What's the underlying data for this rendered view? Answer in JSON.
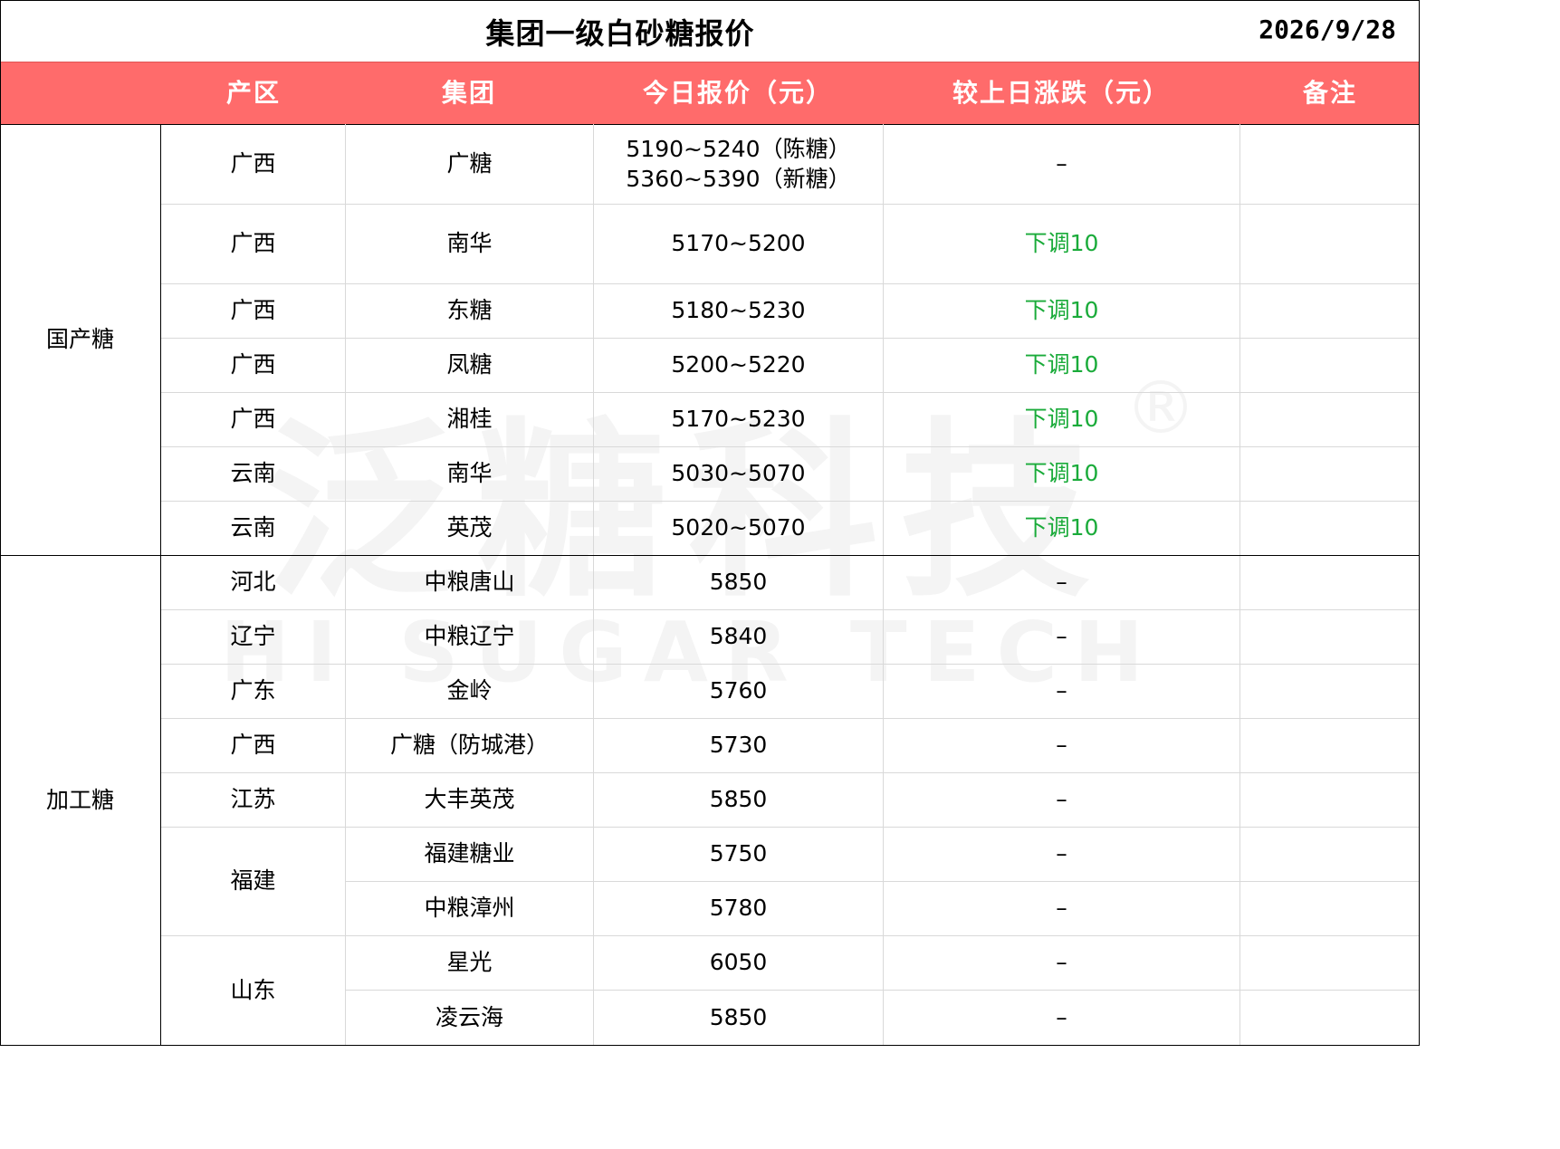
{
  "title": "集团一级白砂糖报价",
  "date": "2026/9/28",
  "header_color": "#ff6b6b",
  "up_down_color": "#1aab3a",
  "columns": [
    "产区",
    "集团",
    "今日报价（元）",
    "较上日涨跌（元）",
    "备注"
  ],
  "categories": [
    "国产糖",
    "加工糖"
  ],
  "regions": [
    "广西",
    "广西",
    "广西",
    "广西",
    "广西",
    "云南",
    "云南",
    "河北",
    "辽宁",
    "广东",
    "广西",
    "江苏",
    "福建",
    "山东"
  ],
  "rows": [
    {
      "group": "广糖",
      "price": "5190~5240（陈糖）",
      "price2": "5360~5390（新糖）",
      "change": "–"
    },
    {
      "group": "南华",
      "price": "5170~5200",
      "change": "下调10"
    },
    {
      "group": "东糖",
      "price": "5180~5230",
      "change": "下调10"
    },
    {
      "group": "凤糖",
      "price": "5200~5220",
      "change": "下调10"
    },
    {
      "group": "湘桂",
      "price": "5170~5230",
      "change": "下调10"
    },
    {
      "group": "南华",
      "price": "5030~5070",
      "change": "下调10"
    },
    {
      "group": "英茂",
      "price": "5020~5070",
      "change": "下调10"
    },
    {
      "group": "中粮唐山",
      "price": "5850",
      "change": "–"
    },
    {
      "group": "中粮辽宁",
      "price": "5840",
      "change": "–"
    },
    {
      "group": "金岭",
      "price": "5760",
      "change": "–"
    },
    {
      "group": "广糖（防城港）",
      "price": "5730",
      "change": "–"
    },
    {
      "group": "大丰英茂",
      "price": "5850",
      "change": "–"
    },
    {
      "group": "福建糖业",
      "price": "5750",
      "change": "–"
    },
    {
      "group": "中粮漳州",
      "price": "5780",
      "change": "–"
    },
    {
      "group": "星光",
      "price": "6050",
      "change": "–"
    },
    {
      "group": "凌云海",
      "price": "5850",
      "change": "–"
    }
  ],
  "watermark": {
    "cn": "泛糖科技",
    "en": "HI SUGAR TECH",
    "mark": "®"
  }
}
